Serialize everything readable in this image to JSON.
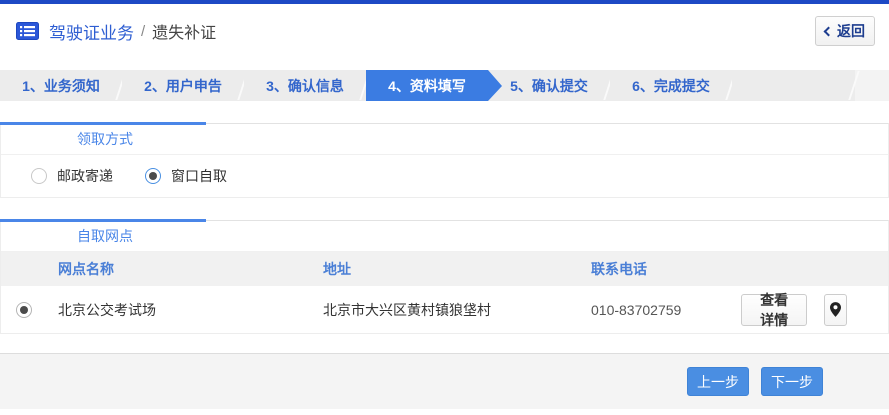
{
  "header": {
    "title_primary": "驾驶证业务",
    "title_separator": "/",
    "title_secondary": "遗失补证",
    "back_label": "返回"
  },
  "steps": {
    "active_index": 3,
    "items": [
      {
        "label": "1、业务须知"
      },
      {
        "label": "2、用户申告"
      },
      {
        "label": "3、确认信息"
      },
      {
        "label": "4、资料填写"
      },
      {
        "label": "5、确认提交"
      },
      {
        "label": "6、完成提交"
      }
    ]
  },
  "pickup": {
    "tab_label": "领取方式",
    "options": [
      {
        "label": "邮政寄递",
        "selected": false
      },
      {
        "label": "窗口自取",
        "selected": true
      }
    ]
  },
  "network": {
    "tab_label": "自取网点",
    "table": {
      "headers": {
        "name": "网点名称",
        "address": "地址",
        "phone": "联系电话"
      },
      "rows": [
        {
          "selected": true,
          "name": "北京公交考试场",
          "address": "北京市大兴区黄村镇狼垡村",
          "phone": "010-83702759",
          "detail_label": "查看详情",
          "map_icon": "location-pin-icon"
        }
      ]
    }
  },
  "footer": {
    "prev_label": "上一步",
    "next_label": "下一步"
  },
  "colors": {
    "top_bar_blue": "#1d49c5",
    "active_step_blue": "#3b7ce2",
    "tab_accent_blue": "#4a86e8",
    "link_blue": "#2e5ed2",
    "button_blue": "#4a8ee2"
  }
}
